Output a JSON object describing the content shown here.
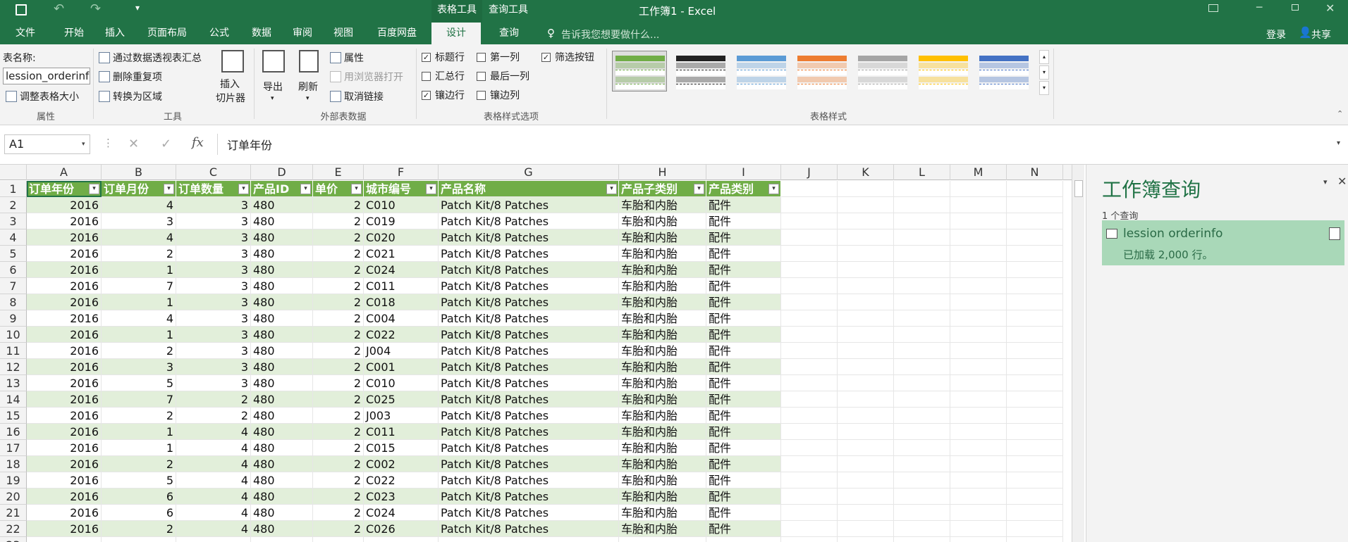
{
  "window": {
    "title": "工作簿1 - Excel",
    "context_tabs": [
      "表格工具",
      "查询工具"
    ],
    "icons": [
      "save-icon",
      "undo-icon",
      "redo-icon",
      "customize-icon"
    ]
  },
  "tabs": [
    "文件",
    "开始",
    "插入",
    "页面布局",
    "公式",
    "数据",
    "审阅",
    "视图",
    "百度网盘",
    "设计",
    "查询"
  ],
  "tell_me": "告诉我您想要做什么...",
  "account": {
    "login": "登录",
    "share": "共享"
  },
  "ribbon": {
    "props": {
      "name_label": "表名称:",
      "name_value": "lession_orderinfo",
      "resize": "调整表格大小",
      "group": "属性"
    },
    "tools": {
      "pivot": "通过数据透视表汇总",
      "remove_dup": "删除重复项",
      "convert": "转换为区域",
      "slicer": "插入\n切片器",
      "slicer_l1": "插入",
      "slicer_l2": "切片器",
      "group": "工具"
    },
    "external": {
      "export": "导出",
      "refresh": "刷新",
      "props": "属性",
      "open_browser": "用浏览器打开",
      "unlink": "取消链接",
      "group": "外部表数据"
    },
    "style_opts": {
      "header_row": "标题行",
      "total_row": "汇总行",
      "banded_rows": "镶边行",
      "first_col": "第一列",
      "last_col": "最后一列",
      "banded_cols": "镶边列",
      "filter_btn": "筛选按钮",
      "group": "表格样式选项"
    },
    "styles": {
      "group": "表格样式",
      "colors": [
        "#70ad47",
        "#222222",
        "#5b9bd5",
        "#ed7d31",
        "#a5a5a5",
        "#ffc000",
        "#4472c4"
      ]
    }
  },
  "formula_bar": {
    "name_box": "A1",
    "fx": "fx",
    "value": "订单年份"
  },
  "grid": {
    "columns": [
      "A",
      "B",
      "C",
      "D",
      "E",
      "F",
      "G",
      "H",
      "I",
      "J",
      "K",
      "L",
      "M",
      "N"
    ],
    "headers": [
      "订单年份",
      "订单月份",
      "订单数量",
      "产品ID",
      "单价",
      "城市编号",
      "产品名称",
      "产品子类别",
      "产品类别"
    ],
    "rows": [
      [
        "2016",
        "4",
        "3",
        "480",
        "2",
        "C010",
        "Patch Kit/8 Patches",
        "车胎和内胎",
        "配件"
      ],
      [
        "2016",
        "3",
        "3",
        "480",
        "2",
        "C019",
        "Patch Kit/8 Patches",
        "车胎和内胎",
        "配件"
      ],
      [
        "2016",
        "4",
        "3",
        "480",
        "2",
        "C020",
        "Patch Kit/8 Patches",
        "车胎和内胎",
        "配件"
      ],
      [
        "2016",
        "2",
        "3",
        "480",
        "2",
        "C021",
        "Patch Kit/8 Patches",
        "车胎和内胎",
        "配件"
      ],
      [
        "2016",
        "1",
        "3",
        "480",
        "2",
        "C024",
        "Patch Kit/8 Patches",
        "车胎和内胎",
        "配件"
      ],
      [
        "2016",
        "7",
        "3",
        "480",
        "2",
        "C011",
        "Patch Kit/8 Patches",
        "车胎和内胎",
        "配件"
      ],
      [
        "2016",
        "1",
        "3",
        "480",
        "2",
        "C018",
        "Patch Kit/8 Patches",
        "车胎和内胎",
        "配件"
      ],
      [
        "2016",
        "4",
        "3",
        "480",
        "2",
        "C004",
        "Patch Kit/8 Patches",
        "车胎和内胎",
        "配件"
      ],
      [
        "2016",
        "1",
        "3",
        "480",
        "2",
        "C022",
        "Patch Kit/8 Patches",
        "车胎和内胎",
        "配件"
      ],
      [
        "2016",
        "2",
        "3",
        "480",
        "2",
        "J004",
        "Patch Kit/8 Patches",
        "车胎和内胎",
        "配件"
      ],
      [
        "2016",
        "3",
        "3",
        "480",
        "2",
        "C001",
        "Patch Kit/8 Patches",
        "车胎和内胎",
        "配件"
      ],
      [
        "2016",
        "5",
        "3",
        "480",
        "2",
        "C010",
        "Patch Kit/8 Patches",
        "车胎和内胎",
        "配件"
      ],
      [
        "2016",
        "7",
        "2",
        "480",
        "2",
        "C025",
        "Patch Kit/8 Patches",
        "车胎和内胎",
        "配件"
      ],
      [
        "2016",
        "2",
        "2",
        "480",
        "2",
        "J003",
        "Patch Kit/8 Patches",
        "车胎和内胎",
        "配件"
      ],
      [
        "2016",
        "1",
        "4",
        "480",
        "2",
        "C011",
        "Patch Kit/8 Patches",
        "车胎和内胎",
        "配件"
      ],
      [
        "2016",
        "1",
        "4",
        "480",
        "2",
        "C015",
        "Patch Kit/8 Patches",
        "车胎和内胎",
        "配件"
      ],
      [
        "2016",
        "2",
        "4",
        "480",
        "2",
        "C002",
        "Patch Kit/8 Patches",
        "车胎和内胎",
        "配件"
      ],
      [
        "2016",
        "5",
        "4",
        "480",
        "2",
        "C022",
        "Patch Kit/8 Patches",
        "车胎和内胎",
        "配件"
      ],
      [
        "2016",
        "6",
        "4",
        "480",
        "2",
        "C023",
        "Patch Kit/8 Patches",
        "车胎和内胎",
        "配件"
      ],
      [
        "2016",
        "6",
        "4",
        "480",
        "2",
        "C024",
        "Patch Kit/8 Patches",
        "车胎和内胎",
        "配件"
      ],
      [
        "2016",
        "2",
        "4",
        "480",
        "2",
        "C026",
        "Patch Kit/8 Patches",
        "车胎和内胎",
        "配件"
      ]
    ],
    "numeric_cols": [
      0,
      1,
      2,
      4
    ]
  },
  "query_pane": {
    "title": "工作簿查询",
    "count": "1 个查询",
    "query_name": "lession orderinfo",
    "status": "已加载 2,000 行。"
  }
}
